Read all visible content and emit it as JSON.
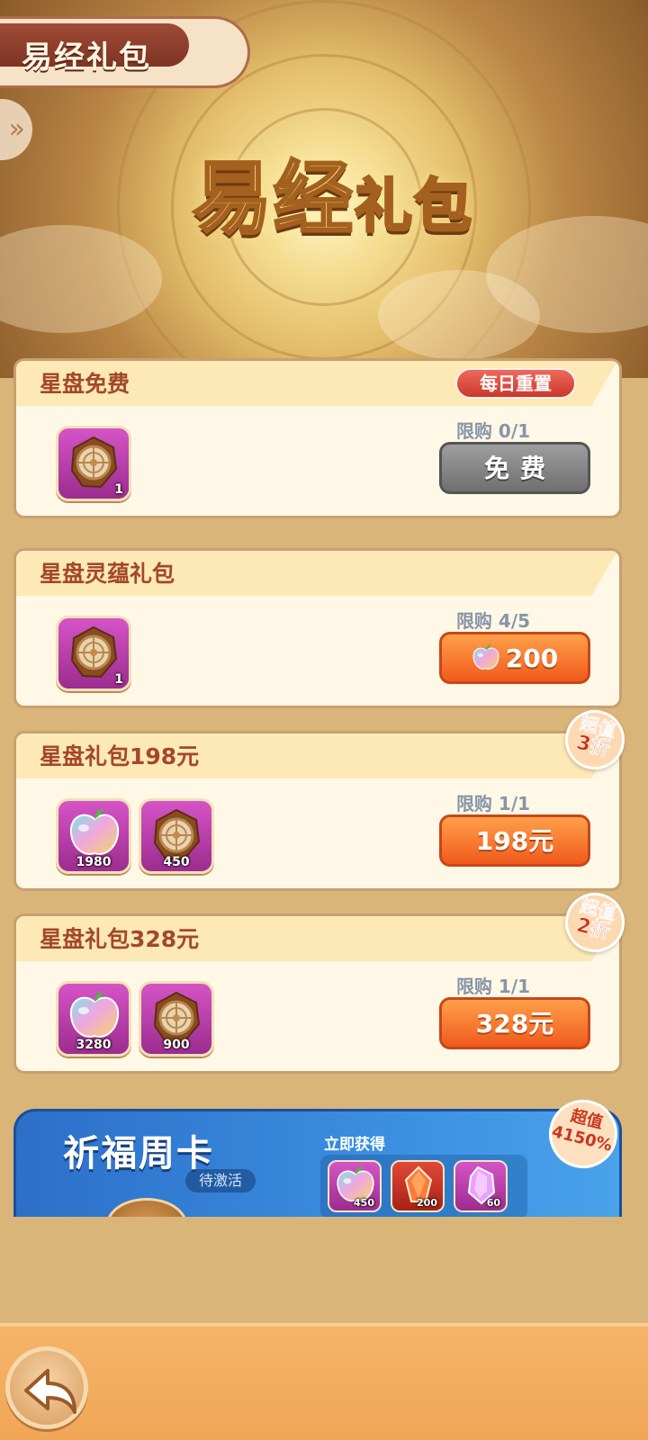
{
  "header": {
    "tab_title": "易经礼包",
    "banner_title_main": "易经",
    "banner_title_sub": "礼包"
  },
  "cards": [
    {
      "title": "星盘免费",
      "badge": "每日重置",
      "limit": "限购 0/1",
      "button": "免费",
      "items": [
        {
          "icon": "star-disc-icon",
          "count": "1"
        }
      ]
    },
    {
      "title": "星盘灵蕴礼包",
      "limit": "限购 4/5",
      "button": "200",
      "button_currency_icon": "rainbow-apple-icon",
      "items": [
        {
          "icon": "star-disc-icon",
          "count": "1"
        }
      ]
    },
    {
      "title": "星盘礼包198元",
      "limit": "限购 1/1",
      "button": "198元",
      "discount_top": "超值",
      "discount_bottom": "3折",
      "items": [
        {
          "icon": "rainbow-apple-icon",
          "count": "1980"
        },
        {
          "icon": "star-disc-icon",
          "count": "450"
        }
      ]
    },
    {
      "title": "星盘礼包328元",
      "limit": "限购 1/1",
      "button": "328元",
      "discount_top": "超值",
      "discount_bottom": "2折",
      "items": [
        {
          "icon": "rainbow-apple-icon",
          "count": "3280"
        },
        {
          "icon": "star-disc-icon",
          "count": "900"
        }
      ]
    }
  ],
  "weekly": {
    "title": "祈福周卡",
    "status": "待激活",
    "get_label": "立即获得",
    "badge_top": "超值",
    "badge_bottom": "4150%",
    "items": [
      {
        "icon": "rainbow-apple-icon",
        "count": "450"
      },
      {
        "icon": "red-crystal-icon",
        "count": "200"
      },
      {
        "icon": "purple-crystal-icon",
        "count": "60"
      }
    ]
  },
  "colors": {
    "accent_orange": "#f05a1c",
    "card_title": "#a4482a",
    "free_button": "#8a8a8a",
    "weekly_blue": "#2c6fc9"
  }
}
